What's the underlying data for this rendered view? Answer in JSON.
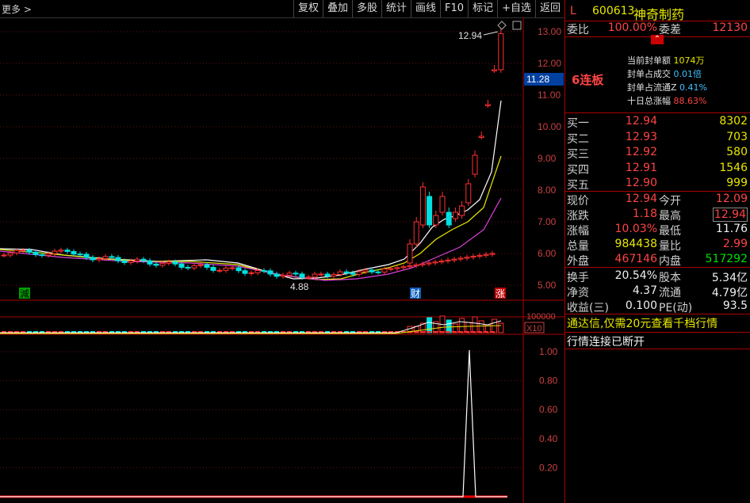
{
  "toolbar": {
    "more": "更多 >",
    "buttons": [
      "复权",
      "叠加",
      "多股",
      "统计",
      "画线",
      "F10",
      "标记",
      "+自选",
      "返回"
    ]
  },
  "main_chart": {
    "price_axis": [
      "13.00",
      "12.00",
      "11.00",
      "10.00",
      "9.00",
      "8.00",
      "7.00",
      "6.00",
      "5.00"
    ],
    "current_price_tag": "11.28",
    "high_label": "12.94",
    "low_label": "4.88",
    "markers": {
      "reduce": "減",
      "finance": "财",
      "limit_up": "涨"
    }
  },
  "volume_panel": {
    "axis_label": "100000",
    "unit": "X10"
  },
  "indicator_panel": {
    "axis": [
      "1.00",
      "0.80",
      "0.60",
      "0.40",
      "0.20"
    ]
  },
  "stock": {
    "l_tag": "L",
    "code": "600613",
    "name": "神奇制药",
    "weibi_label": "委比",
    "weibi": "100.00%",
    "weicha_label": "委差",
    "weicha": "12130",
    "lianban": "6连板",
    "seal": [
      {
        "label": "当前封单额",
        "value": "1074万"
      },
      {
        "label": "封单占成交",
        "value": "0.01倍"
      },
      {
        "label": "封单占流通Z",
        "value": "0.41%"
      },
      {
        "label": "十日总涨幅",
        "value": "88.63%"
      }
    ],
    "bids": [
      {
        "label": "买一",
        "price": "12.94",
        "vol": "8302"
      },
      {
        "label": "买二",
        "price": "12.93",
        "vol": "703"
      },
      {
        "label": "买三",
        "price": "12.92",
        "vol": "580"
      },
      {
        "label": "买四",
        "price": "12.91",
        "vol": "1546"
      },
      {
        "label": "买五",
        "price": "12.90",
        "vol": "999"
      }
    ],
    "quote": [
      {
        "l1": "现价",
        "v1": "12.94",
        "l2": "今开",
        "v2": "12.09"
      },
      {
        "l1": "涨跌",
        "v1": "1.18",
        "l2": "最高",
        "v2": "12.94"
      },
      {
        "l1": "涨幅",
        "v1": "10.03%",
        "l2": "最低",
        "v2": "11.76"
      },
      {
        "l1": "总量",
        "v1": "984438",
        "l2": "量比",
        "v2": "2.99"
      },
      {
        "l1": "外盘",
        "v1": "467146",
        "l2": "内盘",
        "v2": "517292"
      }
    ],
    "fund": [
      {
        "l1": "换手",
        "v1": "20.54%",
        "l2": "股本",
        "v2": "5.34亿"
      },
      {
        "l1": "净资",
        "v1": "4.37",
        "l2": "流通",
        "v2": "4.79亿"
      },
      {
        "l1": "收益(三)",
        "v1": "0.100",
        "l2": "PE(动)",
        "v2": "93.5"
      }
    ],
    "ad_text": "通达信,仅需20元查看千档行情",
    "status_text": "行情连接已断开"
  },
  "chart_data": {
    "type": "candlestick",
    "price_axis_range": [
      4.6,
      13.3
    ],
    "highlighted": {
      "high": 12.94,
      "low": 4.88,
      "last_tag": 11.28
    }
  }
}
